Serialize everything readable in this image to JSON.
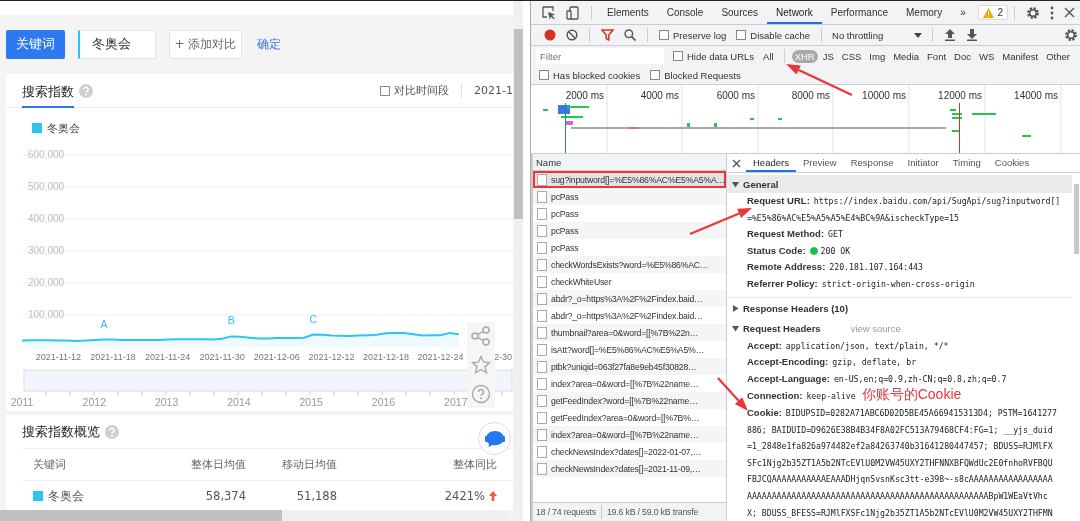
{
  "page": {
    "search_bar": {
      "keyword_button": "关键词",
      "keyword_field": "冬奥会",
      "add_compare_button": "+ 添加对比",
      "confirm_link": "确定"
    },
    "index_card": {
      "title": "搜索指数",
      "compare_period": {
        "label": "对比时间段",
        "checked": false
      },
      "date_range": "2021-1",
      "chart_data": {
        "type": "line",
        "categories": [
          null,
          null,
          null,
          null,
          "2021-11-12",
          null,
          null,
          null,
          null,
          null,
          "2021-11-18",
          null,
          null,
          null,
          null,
          null,
          "2021-11-24",
          null,
          null,
          null,
          null,
          null,
          "2021-11-30",
          null,
          null,
          null,
          null,
          null,
          "2021-12-06",
          null,
          null,
          null,
          null,
          null,
          "2021-12-12",
          null,
          null,
          null,
          null,
          null,
          "2021-12-18",
          null,
          null,
          null,
          null,
          null,
          "2021-12-24",
          null,
          null,
          null,
          null,
          null,
          "2-30",
          null,
          null
        ],
        "yticks": [
          {
            "value": 100000,
            "label": "100,000"
          },
          {
            "value": 200000,
            "label": "200,000"
          },
          {
            "value": 300000,
            "label": "300,000"
          },
          {
            "value": 400000,
            "label": "400,000"
          },
          {
            "value": 500000,
            "label": "500,000"
          },
          {
            "value": 600000,
            "label": "600,000"
          }
        ],
        "ylim": [
          0,
          600000
        ],
        "series": [
          {
            "name": "冬奥会",
            "color": "#2ec4f2",
            "values": [
              20000,
              21000,
              21000,
              21000,
              20000,
              20000,
              19000,
              20000,
              22000,
              23000,
              23000,
              22000,
              22000,
              22000,
              22000,
              22000,
              23000,
              24000,
              24000,
              24000,
              24000,
              23000,
              26000,
              33000,
              32000,
              29000,
              27000,
              27000,
              28000,
              28000,
              28000,
              29000,
              39000,
              38000,
              36000,
              35000,
              34000,
              36000,
              37000,
              38000,
              43000,
              44000,
              44000,
              40000,
              36000,
              37000,
              37000,
              44000,
              40000,
              null,
              null,
              null,
              null,
              null,
              null
            ]
          }
        ],
        "grid": true,
        "annotations": [
          "A",
          "B",
          "C"
        ]
      },
      "navigator_years": [
        "2011",
        "2012",
        "2013",
        "2014",
        "2015",
        "2016",
        "2017"
      ]
    },
    "overview_card": {
      "title": "搜索指数概览",
      "columns": [
        "关键词",
        "整体日均值",
        "移动日均值",
        "整体同比"
      ],
      "rows": [
        {
          "keyword": "冬奥会",
          "color": "#2ec4f2",
          "overall_avg": "58,374",
          "mobile_avg": "51,188",
          "yoy": "2421%",
          "rising": true
        }
      ]
    }
  },
  "devtools": {
    "panel_tabs": [
      {
        "label": "Elements",
        "selected": false
      },
      {
        "label": "Console",
        "selected": false
      },
      {
        "label": "Sources",
        "selected": false
      },
      {
        "label": "Network",
        "selected": true
      },
      {
        "label": "Performance",
        "selected": false
      },
      {
        "label": "Memory",
        "selected": false
      }
    ],
    "more_tabs": "»",
    "warning_count": "2",
    "toolbar": {
      "recording": true,
      "preserve_log": {
        "label": "Preserve log",
        "checked": false
      },
      "disable_cache": {
        "label": "Disable cache",
        "checked": false
      },
      "throttling": "No throttling"
    },
    "filter": {
      "placeholder": "Filter",
      "hide_data_urls": {
        "label": "Hide data URLs",
        "checked": false
      },
      "types": [
        {
          "label": "All",
          "selected": false
        },
        {
          "label": "XHR",
          "selected": true
        },
        {
          "label": "JS",
          "selected": false
        },
        {
          "label": "CSS",
          "selected": false
        },
        {
          "label": "Img",
          "selected": false
        },
        {
          "label": "Media",
          "selected": false
        },
        {
          "label": "Font",
          "selected": false
        },
        {
          "label": "Doc",
          "selected": false
        },
        {
          "label": "WS",
          "selected": false
        },
        {
          "label": "Manifest",
          "selected": false
        },
        {
          "label": "Other",
          "selected": false
        }
      ]
    },
    "blocked_filters": [
      {
        "label": "Has blocked cookies",
        "checked": false
      },
      {
        "label": "Blocked Requests",
        "checked": false
      }
    ],
    "timeline_ticks": [
      "2000 ms",
      "4000 ms",
      "6000 ms",
      "8000 ms",
      "10000 ms",
      "12000 ms",
      "14000 ms"
    ],
    "requests_header": "Name",
    "requests": [
      {
        "name": "sug?inputword[]=%E5%86%AC%E5%A5%A…",
        "selected": true,
        "highlighted": true
      },
      {
        "name": "pcPass",
        "selected": false,
        "highlighted": false
      },
      {
        "name": "pcPass",
        "selected": false,
        "highlighted": false
      },
      {
        "name": "pcPass",
        "selected": false,
        "highlighted": false
      },
      {
        "name": "pcPass",
        "selected": false,
        "highlighted": false
      },
      {
        "name": "checkWordsExists?word=%E5%86%AC…",
        "selected": false,
        "highlighted": false
      },
      {
        "name": "checkWhiteUser",
        "selected": false,
        "highlighted": false
      },
      {
        "name": "abdr?_o=https%3A%2F%2Findex.baid…",
        "selected": false,
        "highlighted": false
      },
      {
        "name": "abdr?_o=https%3A%2F%2Findex.baid…",
        "selected": false,
        "highlighted": false
      },
      {
        "name": "thumbnail?area=0&word=[[%7B%22n…",
        "selected": false,
        "highlighted": false
      },
      {
        "name": "isAtt?word[]=%E5%86%AC%E5%A5%…",
        "selected": false,
        "highlighted": false
      },
      {
        "name": "ptbk?uniqid=063f27fa8e9eb45f30828…",
        "selected": false,
        "highlighted": false
      },
      {
        "name": "index?area=0&word=[[%7B%22name…",
        "selected": false,
        "highlighted": false
      },
      {
        "name": "getFeedIndex?word=[[%7B%22name…",
        "selected": false,
        "highlighted": false
      },
      {
        "name": "getFeedIndex?area=0&word=[[%7B%…",
        "selected": false,
        "highlighted": false
      },
      {
        "name": "index?area=0&word=[[%7B%22name…",
        "selected": false,
        "highlighted": false
      },
      {
        "name": "checkNewsIndex?dates[]=2022-01-07,…",
        "selected": false,
        "highlighted": false
      },
      {
        "name": "checkNewsIndex?dates[]=2021-11-09,…",
        "selected": false,
        "highlighted": false
      }
    ],
    "status": [
      "18 / 74 requests",
      "19.6 kB / 59.0 kB transfe"
    ],
    "detail_tabs": [
      {
        "label": "Headers",
        "selected": true
      },
      {
        "label": "Preview",
        "selected": false
      },
      {
        "label": "Response",
        "selected": false
      },
      {
        "label": "Initiator",
        "selected": false
      },
      {
        "label": "Timing",
        "selected": false
      },
      {
        "label": "Cookies",
        "selected": false
      }
    ],
    "sections": [
      {
        "title": "General",
        "expanded": true,
        "focused": true,
        "fields": [
          {
            "kind": "text",
            "key": "Request URL:",
            "value_lines": [
              "https://index.baidu.com/api/SugApi/sug?inputword[]",
              "=%E5%86%AC%E5%A5%A5%E4%BC%9A&ischeckType=15"
            ]
          },
          {
            "kind": "text",
            "key": "Request Method:",
            "value_lines": [
              "GET"
            ]
          },
          {
            "kind": "status",
            "key": "Status Code:",
            "value_lines": [
              "200 OK"
            ]
          },
          {
            "kind": "text",
            "key": "Remote Address:",
            "value_lines": [
              "220.181.107.164:443"
            ]
          },
          {
            "kind": "text",
            "key": "Referrer Policy:",
            "value_lines": [
              "strict-origin-when-cross-origin"
            ]
          }
        ]
      },
      {
        "title": "Response Headers (10)",
        "expanded": false,
        "focused": false
      },
      {
        "title": "Request Headers",
        "expanded": true,
        "focused": false,
        "link": "view source",
        "fields": [
          {
            "kind": "text",
            "key": "Accept:",
            "value_lines": [
              "application/json, text/plain, */*"
            ]
          },
          {
            "kind": "text",
            "key": "Accept-Encoding:",
            "value_lines": [
              "gzip, deflate, br"
            ]
          },
          {
            "kind": "text",
            "key": "Accept-Language:",
            "value_lines": [
              "en-US,en;q=0.9,zh-CN;q=0.8,zh;q=0.7"
            ]
          },
          {
            "kind": "text",
            "key": "Connection:",
            "value_lines": [
              "keep-alive"
            ],
            "annotation": "你账号的Cookie"
          },
          {
            "kind": "text",
            "key": "Cookie:",
            "value_lines": [
              "BIDUPSID=0282A71ABC6D02D5BE45A669415313D4; PSTM=1641277",
              "886; BAIDUID=D9626E38B4B34F8A02FC513A79468CF4:FG=1; __yjs_duid",
              "=1_2848e1fa826a974482ef2a84263740b31641280447457; BDUSS=RJMlFX",
              "SFc1Njg2b35ZT1A5b2NTcEVlU0M2VW45UXY2THFNNXBFQWdUc2E0fnhoRVFBQU",
              "FBJCQAAAAAAAAAAAEAAADHjqnSvsnKsc3tt-e398~-s8cAAAAAAAAAAAAAAAAA",
              "AAAAAAAAAAAAAAAAAAAAAAAAAAAAAAAAAAAAAAAAAAAAAAAAABpW1WEaVtVhc",
              "X; BDUSS_BFESS=RJMlFXSFc1Njg2b35ZT1A5b2NTcEVlU0M2VW45UXY2THFMN"
            ]
          }
        ]
      }
    ]
  }
}
